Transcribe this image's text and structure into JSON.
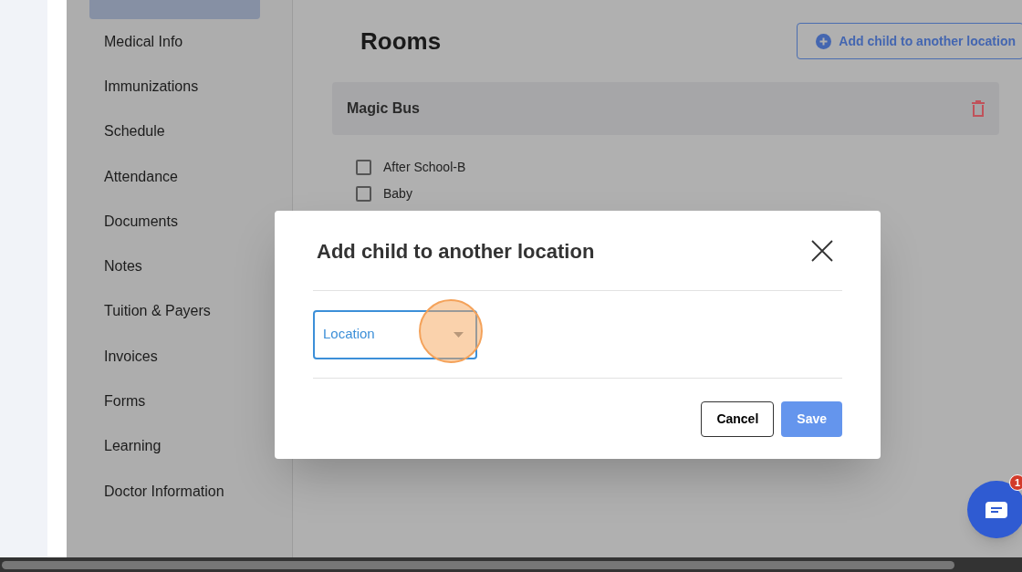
{
  "sidebar": {
    "items": [
      {
        "selected": true
      },
      {
        "label": "Medical Info",
        "selected": false
      },
      {
        "label": "Immunizations",
        "selected": false
      },
      {
        "label": "Schedule",
        "selected": false
      },
      {
        "label": "Attendance",
        "selected": false
      },
      {
        "label": "Documents",
        "selected": false
      },
      {
        "label": "Notes",
        "selected": false
      },
      {
        "label": "Tuition & Payers",
        "selected": false
      },
      {
        "label": "Invoices",
        "selected": false
      },
      {
        "label": "Forms",
        "selected": false
      },
      {
        "label": "Learning",
        "selected": false
      },
      {
        "label": "Doctor Information",
        "selected": false
      }
    ]
  },
  "page": {
    "title": "Rooms",
    "action_button": "Add child to another location",
    "location_card": {
      "name": "Magic Bus",
      "rooms": [
        {
          "label": "After School-B",
          "checked": false
        },
        {
          "label": "Baby",
          "checked": false
        }
      ]
    }
  },
  "dialog": {
    "title": "Add child to another location",
    "select": {
      "placeholder": "Location"
    },
    "buttons": [
      "Cancel",
      "Save"
    ]
  },
  "chat": {
    "badge": "1"
  }
}
